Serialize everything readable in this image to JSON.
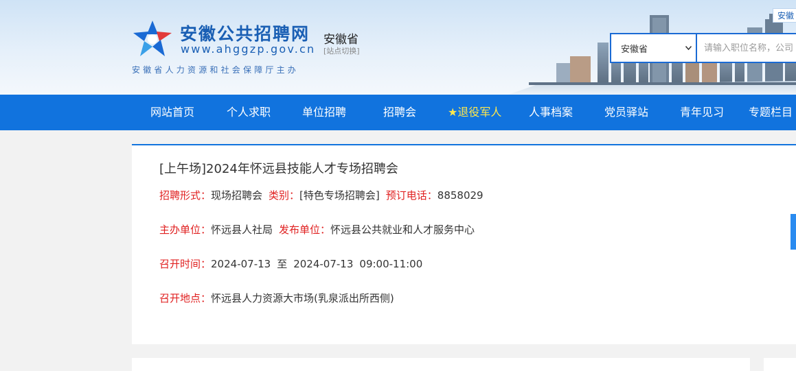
{
  "header": {
    "logo_cn": "安徽公共招聘网",
    "logo_url": "www.ahggzp.gov.cn",
    "region_name": "安徽省",
    "region_switch": "[站点切换]",
    "slogan": "安徽省人力资源和社会保障厅主办",
    "corner_tag": "安徽",
    "brand_color": "#1a5fb4"
  },
  "search": {
    "selected_region": "安徽省",
    "placeholder": "请输入职位名称，公司"
  },
  "nav": {
    "background": "#1173de",
    "items": [
      {
        "label": "网站首页"
      },
      {
        "label": "个人求职"
      },
      {
        "label": "单位招聘"
      },
      {
        "label": "招聘会"
      },
      {
        "label": "★退役军人"
      },
      {
        "label": "人事档案"
      },
      {
        "label": "党员驿站"
      },
      {
        "label": "青年见习"
      },
      {
        "label": "专题栏目"
      }
    ]
  },
  "fair": {
    "title": "[上午场]2024年怀远县技能人才专场招聘会",
    "form_label": "招聘形式：",
    "form_value": "现场招聘会",
    "category_label": "类别：",
    "category_value": "[特色专场招聘会]",
    "phone_label": "预订电话：",
    "phone_value": "8858029",
    "organizer_label": "主办单位：",
    "organizer_value": "怀远县人社局",
    "publisher_label": "发布单位：",
    "publisher_value": "怀远县公共就业和人才服务中心",
    "time_label": "召开时间：",
    "time_start": "2024-07-13",
    "time_sep": "至",
    "time_end": "2024-07-13",
    "time_hours": "09:00-11:00",
    "place_label": "召开地点：",
    "place_value": "怀远县人力资源大市场(乳泉派出所西侧)",
    "label_color": "#e02020"
  }
}
